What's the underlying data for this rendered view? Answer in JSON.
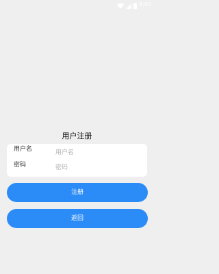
{
  "status_bar": {
    "time": "9:04"
  },
  "page": {
    "title": "用户注册"
  },
  "form": {
    "username_label": "用户名",
    "username_placeholder": "用户名",
    "password_label": "密码",
    "password_placeholder": "密码"
  },
  "buttons": {
    "register_label": "注册",
    "back_label": "返回"
  },
  "colors": {
    "accent": "#2b8cf7",
    "background": "#efefef"
  }
}
